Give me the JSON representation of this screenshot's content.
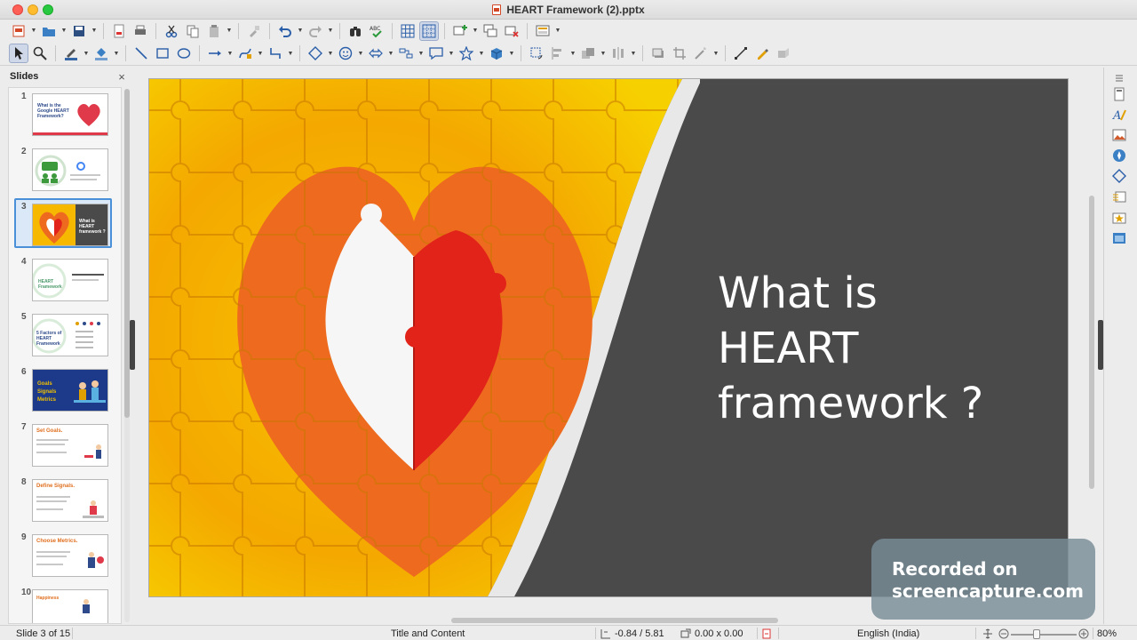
{
  "window": {
    "title": "HEART Framework (2).pptx"
  },
  "slides_pane": {
    "title": "Slides",
    "close_glyph": "×",
    "slides": [
      {
        "num": "1",
        "thumb_text": "What is the Google HEART Framework?"
      },
      {
        "num": "2",
        "thumb_text": ""
      },
      {
        "num": "3",
        "thumb_text": "What is HEART framework ?"
      },
      {
        "num": "4",
        "thumb_text": "HEART Framework"
      },
      {
        "num": "5",
        "thumb_text": "5 Factors of HEART Framework"
      },
      {
        "num": "6",
        "thumb_text": "Goals Signals Metrics"
      },
      {
        "num": "7",
        "thumb_text": "Set Goals."
      },
      {
        "num": "8",
        "thumb_text": "Define Signals."
      },
      {
        "num": "9",
        "thumb_text": "Choose Metrics."
      },
      {
        "num": "10",
        "thumb_text": "Happiness"
      }
    ]
  },
  "slide": {
    "text_line1": "What is",
    "text_line2": "HEART",
    "text_line3": "framework ?"
  },
  "watermark": {
    "line1": "Recorded on",
    "line2": "screencapture.com"
  },
  "statusbar": {
    "slide_info": "Slide 3 of 15",
    "layout": "Title and Content",
    "position": "-0.84 / 5.81",
    "size": "0.00 x 0.00",
    "language": "English (India)",
    "zoom": "80%"
  },
  "colors": {
    "slide_bg": "#4a4a4a",
    "heart_red": "#e2231a",
    "heart_orange": "#ee6a1f",
    "puzzle_yellow": "#f6b800",
    "selection_blue": "#4a90d9"
  }
}
